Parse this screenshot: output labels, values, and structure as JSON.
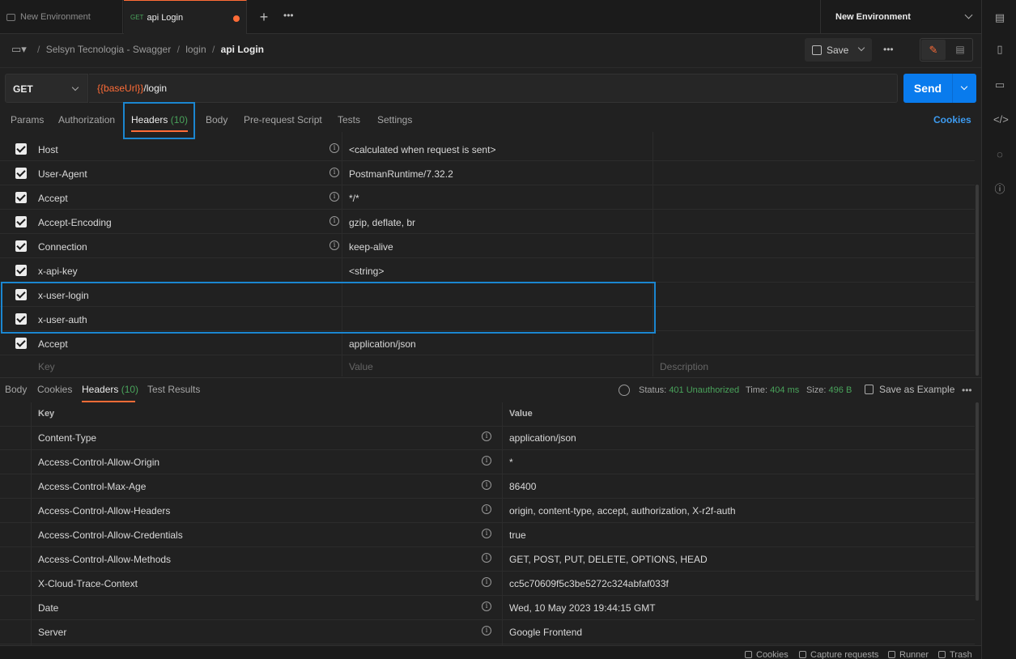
{
  "tabs": {
    "env_tab": "New Environment",
    "api_tab_method": "GET",
    "api_tab_label": "api Login",
    "more": "•••"
  },
  "environment": {
    "selected": "New Environment"
  },
  "breadcrumb": {
    "collection": "Selsyn Tecnologia - Swagger",
    "folder": "login",
    "request": "api Login"
  },
  "toolbar": {
    "save_label": "Save",
    "more": "•••"
  },
  "request": {
    "method": "GET",
    "url_var": "{{baseUrl}}",
    "url_path": "/login",
    "send_label": "Send"
  },
  "request_tabs": {
    "params": "Params",
    "authorization": "Authorization",
    "headers": "Headers",
    "headers_count": "(10)",
    "body": "Body",
    "prerequest": "Pre-request Script",
    "tests": "Tests",
    "settings": "Settings",
    "cookies": "Cookies"
  },
  "request_headers": {
    "rows": [
      {
        "key": "Host",
        "value": "<calculated when request is sent>",
        "info": true
      },
      {
        "key": "User-Agent",
        "value": "PostmanRuntime/7.32.2",
        "info": true
      },
      {
        "key": "Accept",
        "value": "*/*",
        "info": true
      },
      {
        "key": "Accept-Encoding",
        "value": "gzip, deflate, br",
        "info": true
      },
      {
        "key": "Connection",
        "value": "keep-alive",
        "info": true
      },
      {
        "key": "x-api-key",
        "value": "<string>",
        "info": false
      },
      {
        "key": "x-user-login",
        "value": "",
        "info": false
      },
      {
        "key": "x-user-auth",
        "value": "",
        "info": false
      },
      {
        "key": "Accept",
        "value": "application/json",
        "info": false
      }
    ],
    "placeholder": {
      "key": "Key",
      "value": "Value",
      "description": "Description"
    }
  },
  "response_tabs": {
    "body": "Body",
    "cookies": "Cookies",
    "headers": "Headers",
    "headers_count": "(10)",
    "test_results": "Test Results"
  },
  "response_status": {
    "status_label": "Status:",
    "status_value": "401 Unauthorized",
    "time_label": "Time:",
    "time_value": "404 ms",
    "size_label": "Size:",
    "size_value": "496 B",
    "save_example": "Save as Example",
    "more": "•••"
  },
  "response_headers": {
    "columns": {
      "key": "Key",
      "value": "Value"
    },
    "rows": [
      {
        "key": "Content-Type",
        "value": "application/json"
      },
      {
        "key": "Access-Control-Allow-Origin",
        "value": "*"
      },
      {
        "key": "Access-Control-Max-Age",
        "value": "86400"
      },
      {
        "key": "Access-Control-Allow-Headers",
        "value": "origin, content-type, accept, authorization, X-r2f-auth"
      },
      {
        "key": "Access-Control-Allow-Credentials",
        "value": "true"
      },
      {
        "key": "Access-Control-Allow-Methods",
        "value": "GET, POST, PUT, DELETE, OPTIONS, HEAD"
      },
      {
        "key": "X-Cloud-Trace-Context",
        "value": "cc5c70609f5c3be5272c324abfaf033f"
      },
      {
        "key": "Date",
        "value": "Wed, 10 May 2023 19:44:15 GMT"
      },
      {
        "key": "Server",
        "value": "Google Frontend"
      }
    ]
  },
  "footer": {
    "cookies": "Cookies",
    "capture": "Capture requests",
    "runner": "Runner",
    "trash": "Trash"
  },
  "colors": {
    "accent": "#ff6c37",
    "send": "#097bed",
    "success_green": "#49a35b",
    "highlight_box": "#1b86d0"
  }
}
